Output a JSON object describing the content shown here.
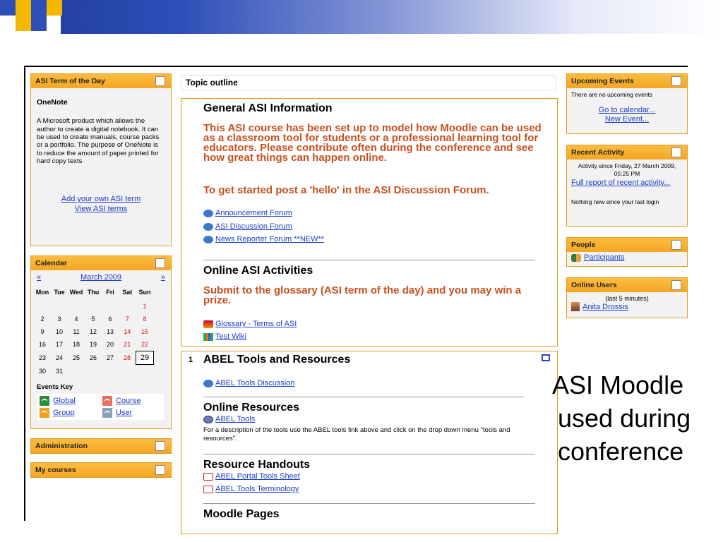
{
  "left": {
    "term_block": {
      "title": "ASI Term of the Day",
      "term": "OneNote",
      "definition": "A Microsoft product which allows the author to create a digital notebook. It can be used to create manuals, course packs or a portfolio. The purpose of OneNote is to reduce the amount of paper printed for hard copy texts",
      "add_link": "Add your own ASI term",
      "view_link": "View ASI terms"
    },
    "calendar": {
      "title": "Calendar",
      "prev": "«",
      "month": "March 2009",
      "next": "»",
      "days": [
        "Mon",
        "Tue",
        "Wed",
        "Thu",
        "Fri",
        "Sat",
        "Sun"
      ],
      "weeks": [
        [
          "",
          "",
          "",
          "",
          "",
          "",
          "1"
        ],
        [
          "2",
          "3",
          "4",
          "5",
          "6",
          "7",
          "8"
        ],
        [
          "9",
          "10",
          "11",
          "12",
          "13",
          "14",
          "15"
        ],
        [
          "16",
          "17",
          "18",
          "19",
          "20",
          "21",
          "22"
        ],
        [
          "23",
          "24",
          "25",
          "26",
          "27",
          "28",
          "29"
        ],
        [
          "30",
          "31",
          "",
          "",
          "",
          "",
          ""
        ]
      ],
      "events_key_title": "Events Key",
      "events_key": [
        {
          "label": "Global",
          "color": "#2e8b3a"
        },
        {
          "label": "Course",
          "color": "#e87060"
        },
        {
          "label": "Group",
          "color": "#f0a020"
        },
        {
          "label": "User",
          "color": "#8aa0b8"
        }
      ]
    },
    "administration_title": "Administration",
    "my_courses_title": "My courses"
  },
  "center": {
    "topic_outline": "Topic outline",
    "section0": {
      "heading": "General ASI Information",
      "para1": "This ASI course has been set up to model how Moodle can be used as a classroom tool for students or a professional learning tool for educators.  Please contribute often during the conference and see how great things can happen online.",
      "para2": "To get started post a 'hello' in the ASI Discussion Forum.",
      "forums": [
        " Announcement Forum",
        " ASI Discussion Forum",
        " News Reporter Forum **NEW**"
      ],
      "heading2": "Online ASI Activities",
      "para3": "Submit to the glossary (ASI term of the day) and you may win a prize.",
      "glossary": " Glossary - Terms of ASI",
      "wiki": " Test Wiki"
    },
    "section1": {
      "number": "1",
      "heading": "ABEL Tools and Resources",
      "discussion": " ABEL Tools Discussion",
      "online_resources": "Online Resources",
      "abel_tools": " ABEL Tools",
      "description": "For a description of the tools use the ABEL tools link above and click on the drop down menu \"tools and resources\".",
      "handouts_heading": "Resource Handouts",
      "handouts": [
        " ABEL Portal Tools Sheet",
        " ABEL Tools Terminology"
      ],
      "moodle_pages": "Moodle Pages"
    }
  },
  "right": {
    "upcoming": {
      "title": "Upcoming Events",
      "none": "There are no upcoming events",
      "go_calendar": "Go to calendar...",
      "new_event": "New Event..."
    },
    "recent": {
      "title": "Recent Activity",
      "since": "Activity since Friday, 27 March 2009, 05:25 PM",
      "full_report": "Full report of recent activity...",
      "nothing": "Nothing new since your last login"
    },
    "people": {
      "title": "People",
      "participants": "Participants"
    },
    "online": {
      "title": "Online Users",
      "window": "(last 5 minutes)",
      "user": "Anita Drossis"
    }
  },
  "caption": {
    "line1": "ASI Moodle",
    "line2": "used during",
    "line3": "conference"
  },
  "colors": {
    "block_header": "#f5a623",
    "link": "#1a3cc8",
    "heading_red": "#c8501e",
    "deco_blue": "#2e4fb8",
    "deco_yellow": "#f5b800"
  }
}
